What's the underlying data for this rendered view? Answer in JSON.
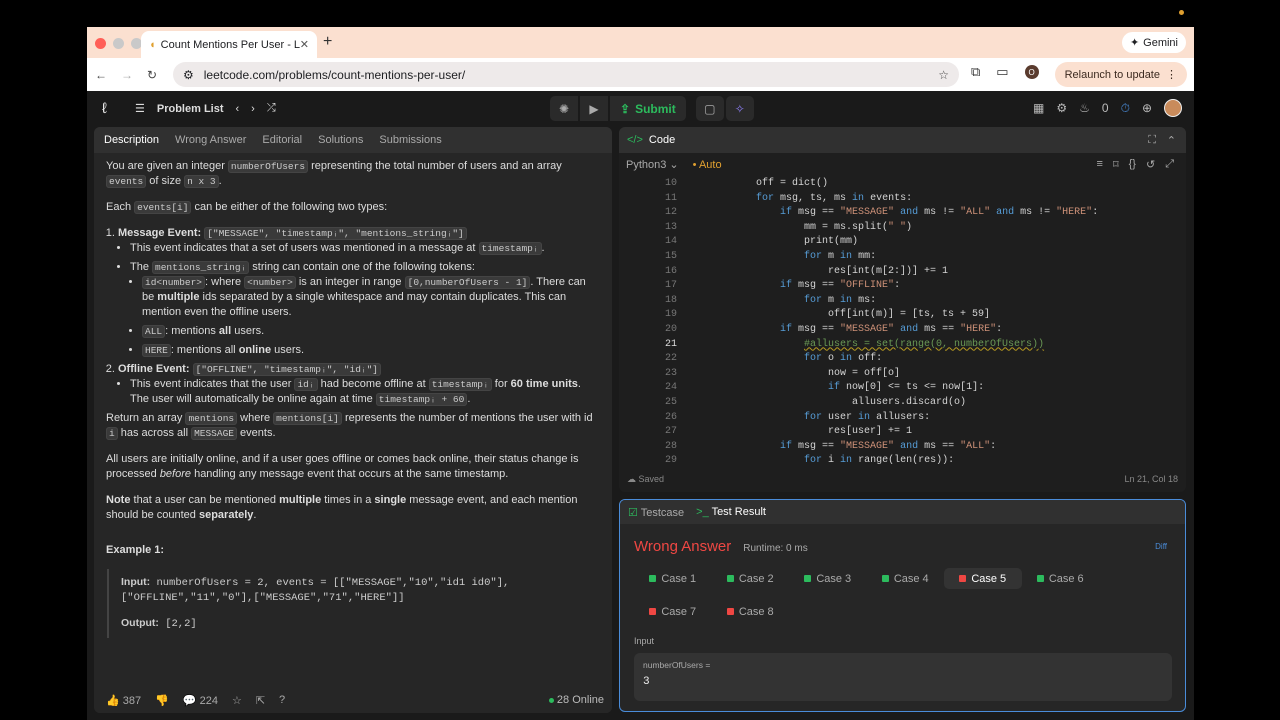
{
  "browser": {
    "tab_title": "Count Mentions Per User - LeetCode",
    "url": "leetcode.com/problems/count-mentions-per-user/",
    "gemini": "Gemini",
    "relaunch": "Relaunch to update",
    "profile_initial": "O"
  },
  "lc": {
    "problem_list": "Problem List",
    "submit": "Submit",
    "streak": "0"
  },
  "left_tabs": [
    "Description",
    "Wrong Answer",
    "Editorial",
    "Solutions",
    "Submissions"
  ],
  "desc": {
    "p1a": "You are given an integer ",
    "p1c1": "numberOfUsers",
    "p1b": " representing the total number of users and an array ",
    "p1c2": "events",
    "p1d": " of size ",
    "p1c3": "n x 3",
    "p1e": ".",
    "p2a": "Each ",
    "p2c": "events[i]",
    "p2b": " can be either of the following two types:",
    "me_title": "Message Event:",
    "me_code": "[\"MESSAGE\", \"timestampᵢ\", \"mentions_stringᵢ\"]",
    "me_b1a": "This event indicates that a set of users was mentioned in a message at ",
    "me_b1c": "timestampᵢ",
    "me_b1b": ".",
    "me_b2a": "The ",
    "me_b2c": "mentions_stringᵢ",
    "me_b2b": " string can contain one of the following tokens:",
    "tok1c": "id<number>",
    "tok1a": ": where ",
    "tok1c2": "<number>",
    "tok1b": " is an integer in range ",
    "tok1c3": "[0,numberOfUsers - 1]",
    "tok1d": ". There can be ",
    "tok1e": "multiple",
    "tok1f": " ids separated by a single whitespace and may contain duplicates. This can mention even the offline users.",
    "tok2c": "ALL",
    "tok2a": ": mentions ",
    "tok2b": "all",
    "tok2d": " users.",
    "tok3c": "HERE",
    "tok3a": ": mentions all ",
    "tok3b": "online",
    "tok3d": " users.",
    "oe_title": "Offline Event:",
    "oe_code": "[\"OFFLINE\", \"timestampᵢ\", \"idᵢ\"]",
    "oe_a": "This event indicates that the user ",
    "oe_c1": "idᵢ",
    "oe_b": " had become offline at ",
    "oe_c2": "timestampᵢ",
    "oe_d": " for ",
    "oe_e": "60 time units",
    "oe_f": ". The user will automatically be online again at time ",
    "oe_c3": "timestampᵢ + 60",
    "oe_g": ".",
    "r_a": "Return an array ",
    "r_c1": "mentions",
    "r_b": " where ",
    "r_c2": "mentions[i]",
    "r_d": " represents the number of mentions the user with id ",
    "r_c3": "i",
    "r_e": " has across all ",
    "r_c4": "MESSAGE",
    "r_f": " events.",
    "all_a": "All users are initially online, and if a user goes offline or comes back online, their status change is processed ",
    "all_b": "before",
    "all_c": " handling any message event that occurs at the same timestamp.",
    "n_a": "Note",
    "n_b": " that a user can be mentioned ",
    "n_c": "multiple",
    "n_d": " times in a ",
    "n_e": "single",
    "n_f": " message event, and each mention should be counted ",
    "n_g": "separately",
    "n_h": ".",
    "ex_title": "Example 1:",
    "ex_input_label": "Input:",
    "ex_input": " numberOfUsers = 2, events = [[\"MESSAGE\",\"10\",\"id1 id0\"],[\"OFFLINE\",\"11\",\"0\"],[\"MESSAGE\",\"71\",\"HERE\"]]",
    "ex_output_label": "Output:",
    "ex_output": " [2,2]"
  },
  "footer": {
    "likes": "387",
    "comments": "224",
    "online": "28 Online"
  },
  "code": {
    "title": "Code",
    "lang": "Python3",
    "auto": "Auto",
    "saved": "Saved",
    "pos": "Ln 21, Col 18"
  },
  "lines": [
    {
      "n": "10",
      "h": "        off = dict()"
    },
    {
      "n": "11",
      "h": "        <span class=\"kw\">for</span> msg, ts, ms <span class=\"kw\">in</span> events:"
    },
    {
      "n": "12",
      "h": "            <span class=\"kw\">if</span> msg == <span class=\"str\">\"MESSAGE\"</span> <span class=\"kw\">and</span> ms != <span class=\"str\">\"ALL\"</span> <span class=\"kw\">and</span> ms != <span class=\"str\">\"HERE\"</span>:"
    },
    {
      "n": "13",
      "h": "                mm = ms.split(<span class=\"str\">\" \"</span>)"
    },
    {
      "n": "14",
      "h": "                print(mm)"
    },
    {
      "n": "15",
      "h": "                <span class=\"kw\">for</span> m <span class=\"kw\">in</span> mm:"
    },
    {
      "n": "16",
      "h": "                    res[int(m[2:])] += 1"
    },
    {
      "n": "17",
      "h": "            <span class=\"kw\">if</span> msg == <span class=\"str\">\"OFFLINE\"</span>:"
    },
    {
      "n": "18",
      "h": "                <span class=\"kw\">for</span> m <span class=\"kw\">in</span> ms:"
    },
    {
      "n": "19",
      "h": "                    off[int(m)] = [ts, ts + 59]"
    },
    {
      "n": "20",
      "h": "            <span class=\"kw\">if</span> msg == <span class=\"str\">\"MESSAGE\"</span> <span class=\"kw\">and</span> ms == <span class=\"str\">\"HERE\"</span>:"
    },
    {
      "n": "21",
      "h": "                <span class=\"cm\">#allusers = set(range(0, numberOfUsers))</span>"
    },
    {
      "n": "22",
      "h": "                <span class=\"kw\">for</span> o <span class=\"kw\">in</span> off:"
    },
    {
      "n": "23",
      "h": "                    now = off[o]"
    },
    {
      "n": "24",
      "h": "                    <span class=\"kw\">if</span> now[0] &lt;= ts &lt;= now[1]:"
    },
    {
      "n": "25",
      "h": "                        allusers.discard(o)"
    },
    {
      "n": "26",
      "h": "                <span class=\"kw\">for</span> user <span class=\"kw\">in</span> allusers:"
    },
    {
      "n": "27",
      "h": "                    res[user] += 1"
    },
    {
      "n": "28",
      "h": "            <span class=\"kw\">if</span> msg == <span class=\"str\">\"MESSAGE\"</span> <span class=\"kw\">and</span> ms == <span class=\"str\">\"ALL\"</span>:"
    },
    {
      "n": "29",
      "h": "                <span class=\"kw\">for</span> i <span class=\"kw\">in</span> range(len(res)):"
    }
  ],
  "result": {
    "tab1": "Testcase",
    "tab2": "Test Result",
    "status": "Wrong Answer",
    "runtime": "Runtime: 0 ms",
    "diff": "Diff",
    "input_label": "Input",
    "var": "numberOfUsers =",
    "val": "3",
    "cases": [
      {
        "l": "Case 1",
        "ok": true
      },
      {
        "l": "Case 2",
        "ok": true
      },
      {
        "l": "Case 3",
        "ok": true
      },
      {
        "l": "Case 4",
        "ok": true
      },
      {
        "l": "Case 5",
        "ok": false,
        "sel": true
      },
      {
        "l": "Case 6",
        "ok": true
      },
      {
        "l": "Case 7",
        "ok": false
      },
      {
        "l": "Case 8",
        "ok": false
      }
    ]
  },
  "colors": {
    "pass": "#2cbb5d",
    "fail": "#ef4743"
  }
}
